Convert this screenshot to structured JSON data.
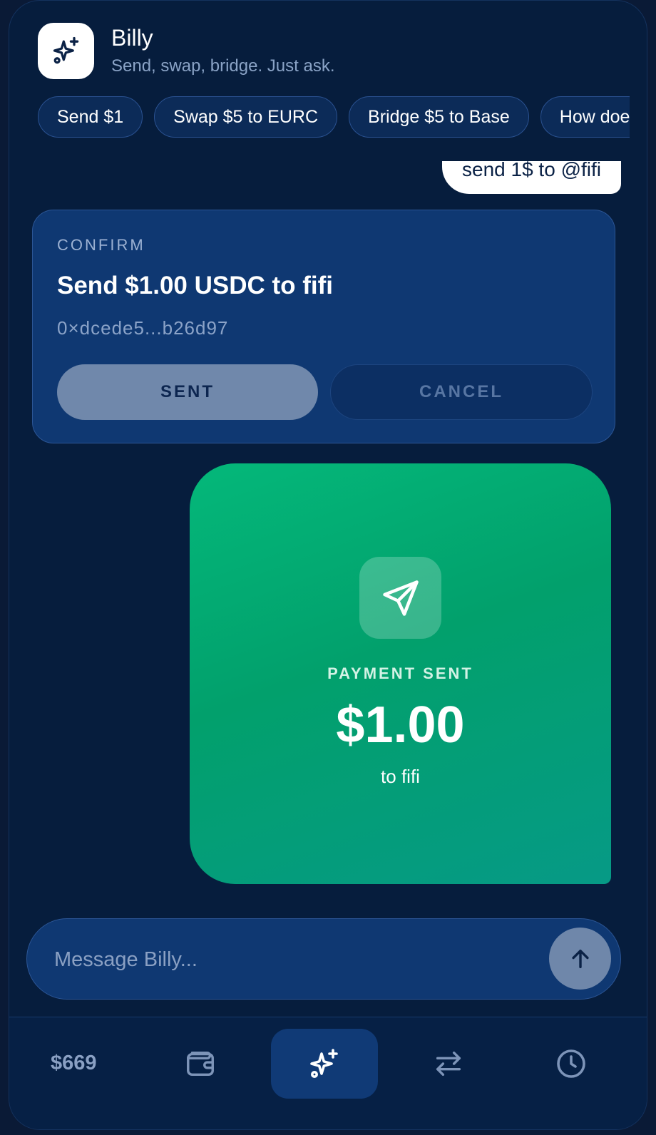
{
  "header": {
    "title": "Billy",
    "subtitle": "Send, swap, bridge. Just ask.",
    "logo_icon": "sparkles-icon"
  },
  "chips": [
    {
      "label": "Send $1"
    },
    {
      "label": "Swap $5 to EURC"
    },
    {
      "label": "Bridge $5 to Base"
    },
    {
      "label": "How doe"
    }
  ],
  "chat": {
    "user_message": "send 1$ to @fifi",
    "confirm": {
      "label": "CONFIRM",
      "title": "Send $1.00 USDC to fifi",
      "address": "0×dcede5...b26d97",
      "sent_label": "SENT",
      "cancel_label": "CANCEL"
    },
    "payment": {
      "icon": "paper-plane-icon",
      "label": "PAYMENT SENT",
      "amount": "$1.00",
      "recipient": "to fifi"
    }
  },
  "composer": {
    "placeholder": "Message Billy...",
    "send_icon": "arrow-up-icon"
  },
  "nav": {
    "balance": "$669",
    "items": [
      "wallet-icon",
      "sparkles-icon",
      "swap-arrows-icon",
      "clock-icon"
    ],
    "active": "sparkles-icon"
  },
  "colors": {
    "background": "#061d3d",
    "card": "#0f3872",
    "accent_green": "#02a06c",
    "muted_text": "#8aa3c6"
  }
}
